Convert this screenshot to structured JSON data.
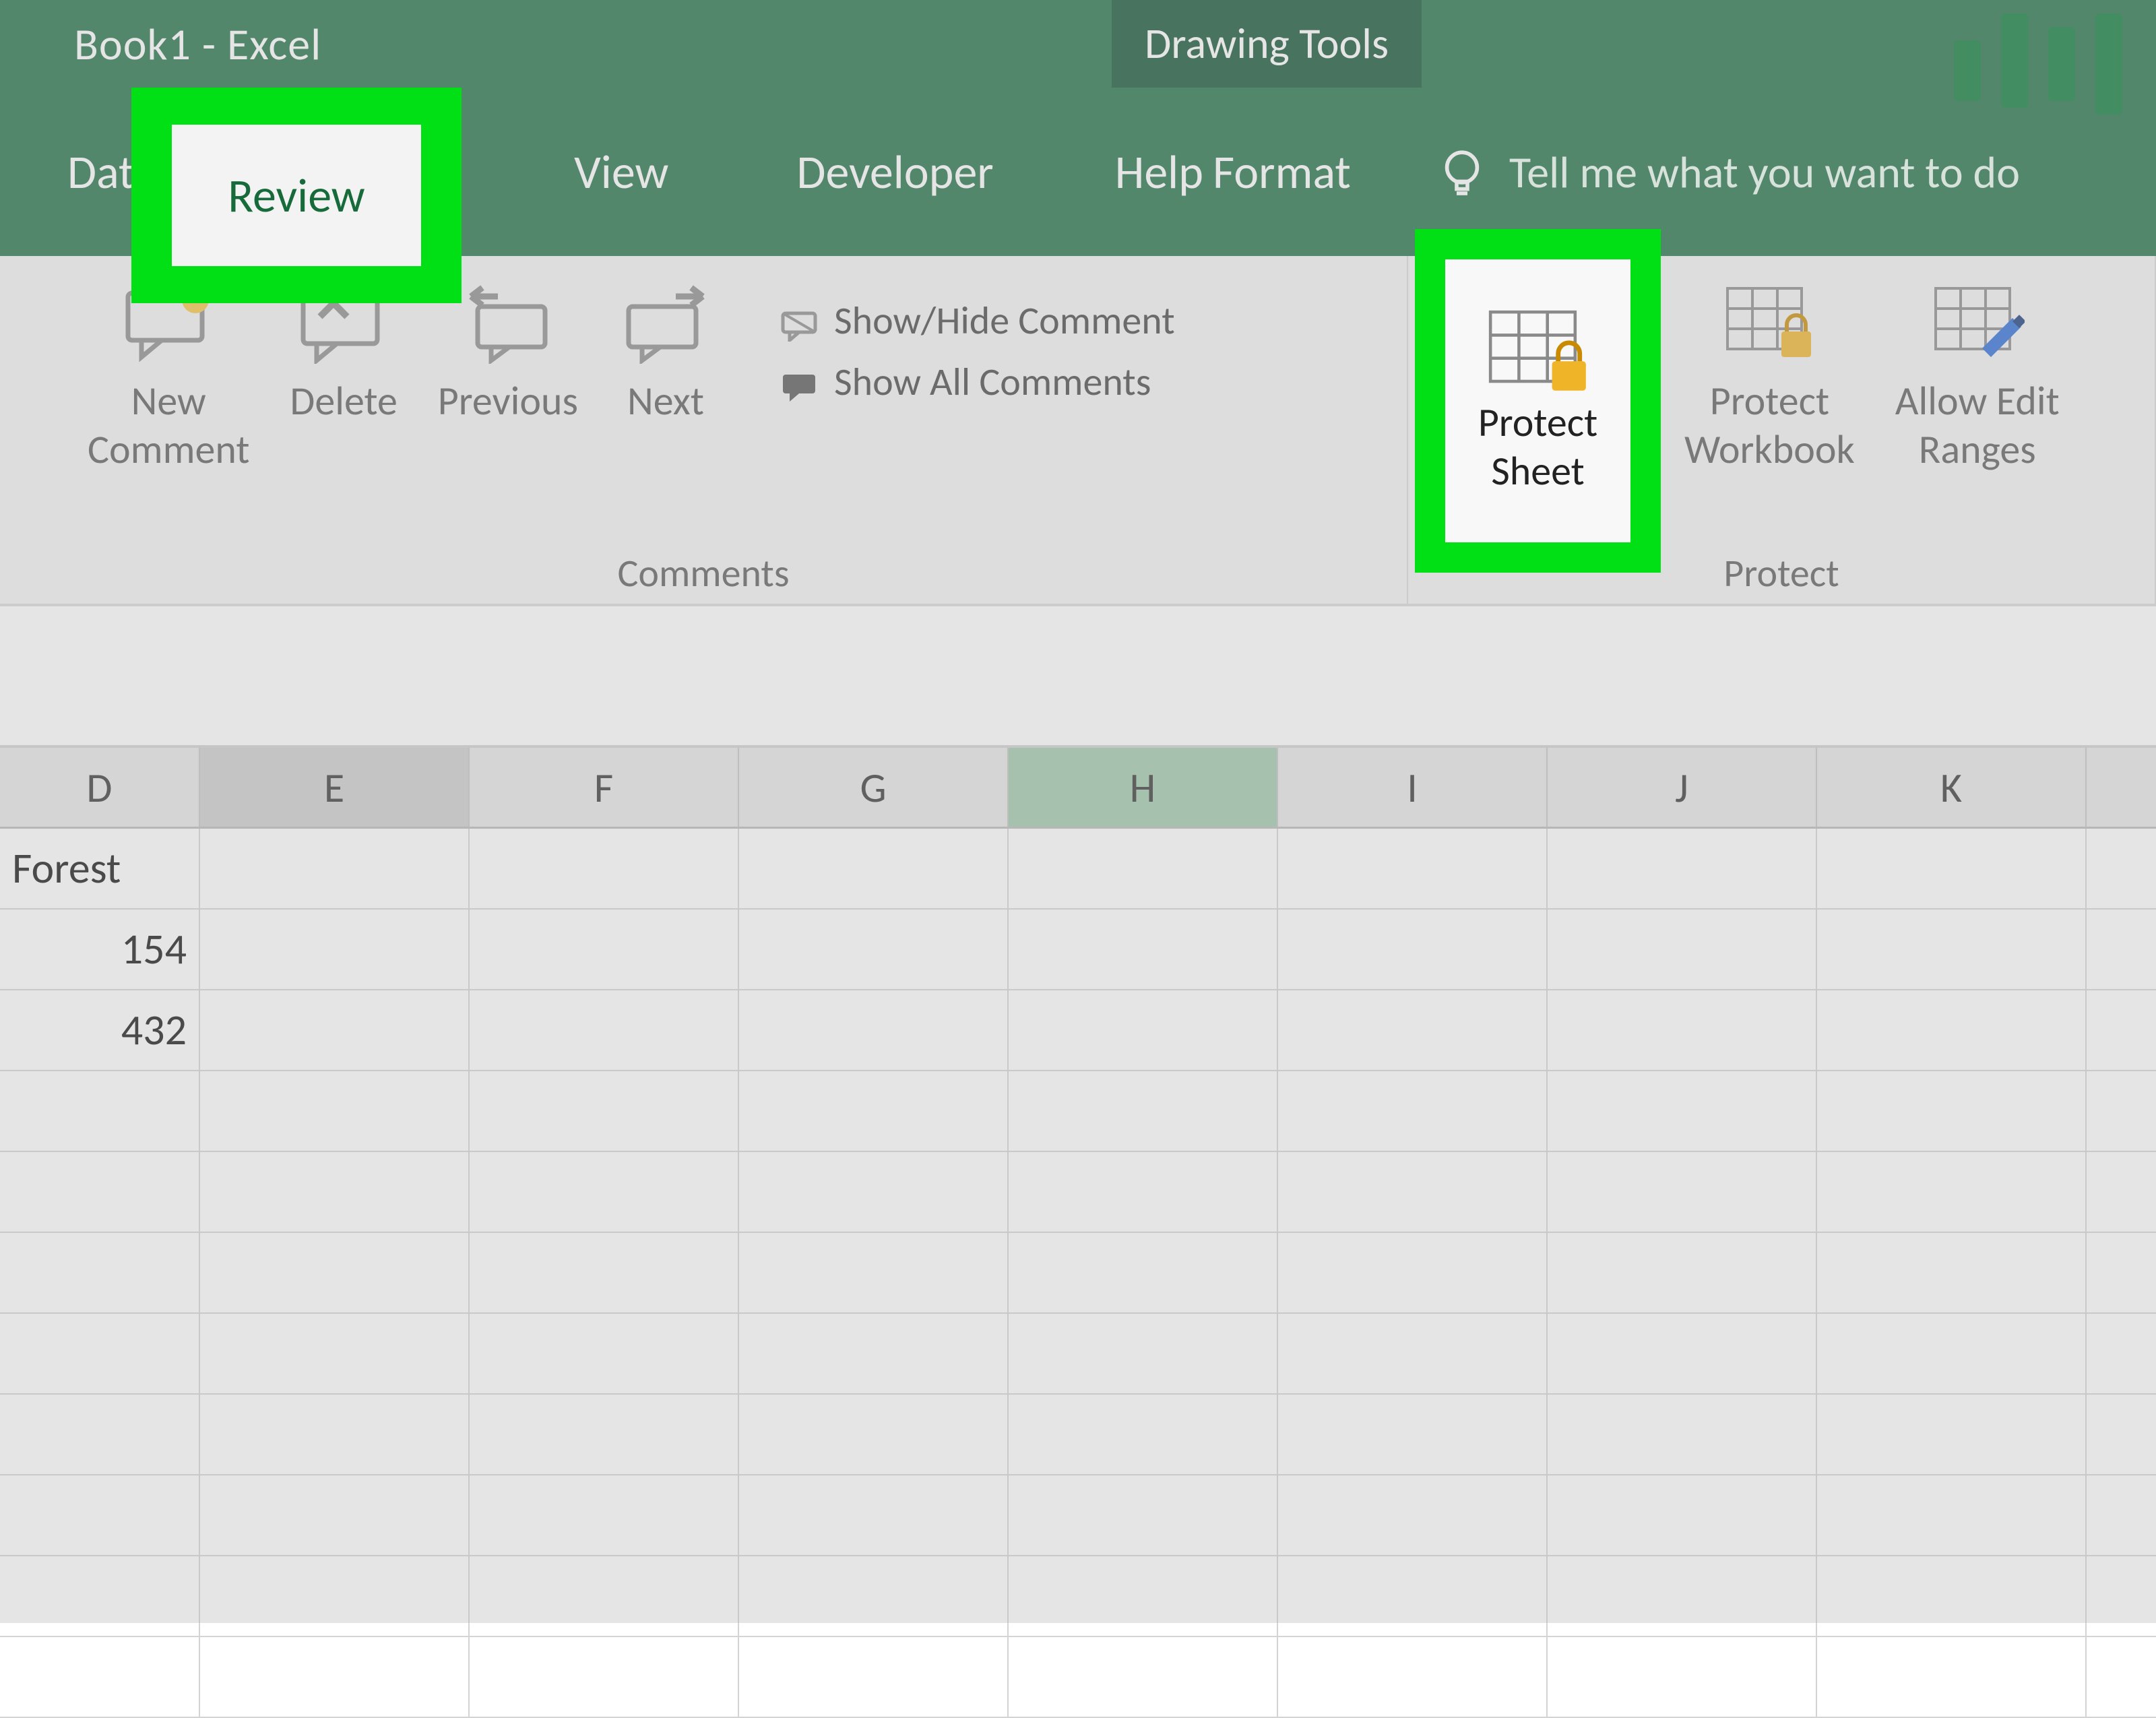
{
  "title": {
    "document": "Book1",
    "separator": "  -  ",
    "app": "Excel",
    "contextual": "Drawing Tools"
  },
  "tabs": {
    "data": "Data",
    "review": "Review",
    "view": "View",
    "developer": "Developer",
    "help": "Help",
    "format": "Format",
    "tellme": "Tell me what you want to do"
  },
  "ribbon": {
    "comments": {
      "group_label": "Comments",
      "new_comment": "New\nComment",
      "delete": "Delete",
      "previous": "Previous",
      "next": "Next",
      "show_hide": "Show/Hide Comment",
      "show_all": "Show All Comments"
    },
    "protect": {
      "group_label": "Protect",
      "protect_sheet": "Protect\nSheet",
      "protect_workbook": "Protect\nWorkbook",
      "allow_edit_ranges": "Allow Edit\nRanges"
    }
  },
  "columns": [
    "D",
    "E",
    "F",
    "G",
    "H",
    "I",
    "J",
    "K"
  ],
  "selected_column_header": "E",
  "active_cell_column": "H",
  "cells": {
    "D1": "Forest",
    "D2": "154",
    "D3": "432"
  },
  "highlights": [
    "review-tab",
    "protect-sheet-button"
  ],
  "colors": {
    "ribbon_green": "#1e6f46",
    "context_green": "#0f5132",
    "highlight_green": "#00e015",
    "selection_green": "#9fc8a9"
  }
}
